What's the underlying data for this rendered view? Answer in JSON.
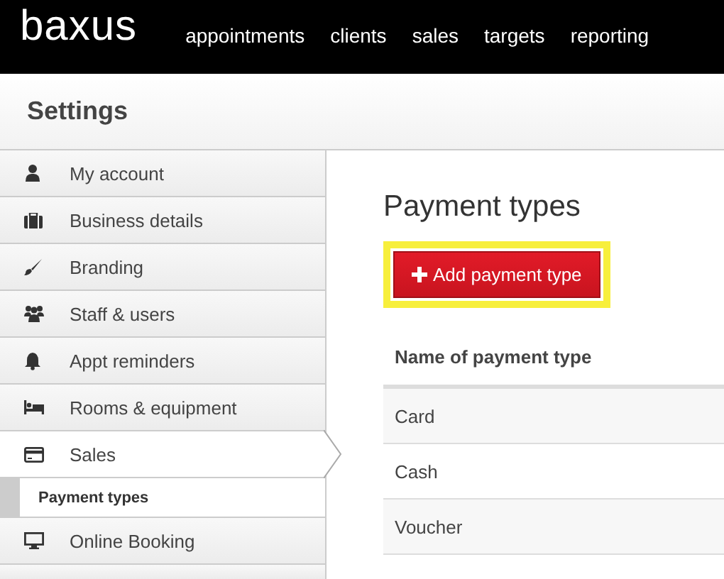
{
  "topbar": {
    "logo": "baxus",
    "nav": [
      "appointments",
      "clients",
      "sales",
      "targets",
      "reporting"
    ]
  },
  "header": {
    "title": "Settings"
  },
  "sidebar": {
    "items": [
      {
        "label": "My account",
        "selected": false
      },
      {
        "label": "Business details",
        "selected": false
      },
      {
        "label": "Branding",
        "selected": false
      },
      {
        "label": "Staff & users",
        "selected": false
      },
      {
        "label": "Appt reminders",
        "selected": false
      },
      {
        "label": "Rooms & equipment",
        "selected": false
      },
      {
        "label": "Sales",
        "selected": true,
        "expanded": true,
        "children": [
          {
            "label": "Payment types",
            "selected": true
          }
        ]
      },
      {
        "label": "Online Booking",
        "selected": false
      }
    ]
  },
  "content": {
    "title": "Payment types",
    "add_button": {
      "label": "Add payment type",
      "highlighted": true
    },
    "table": {
      "columns": [
        "Name of payment type"
      ],
      "rows": [
        [
          "Card"
        ],
        [
          "Cash"
        ],
        [
          "Voucher"
        ]
      ]
    }
  }
}
